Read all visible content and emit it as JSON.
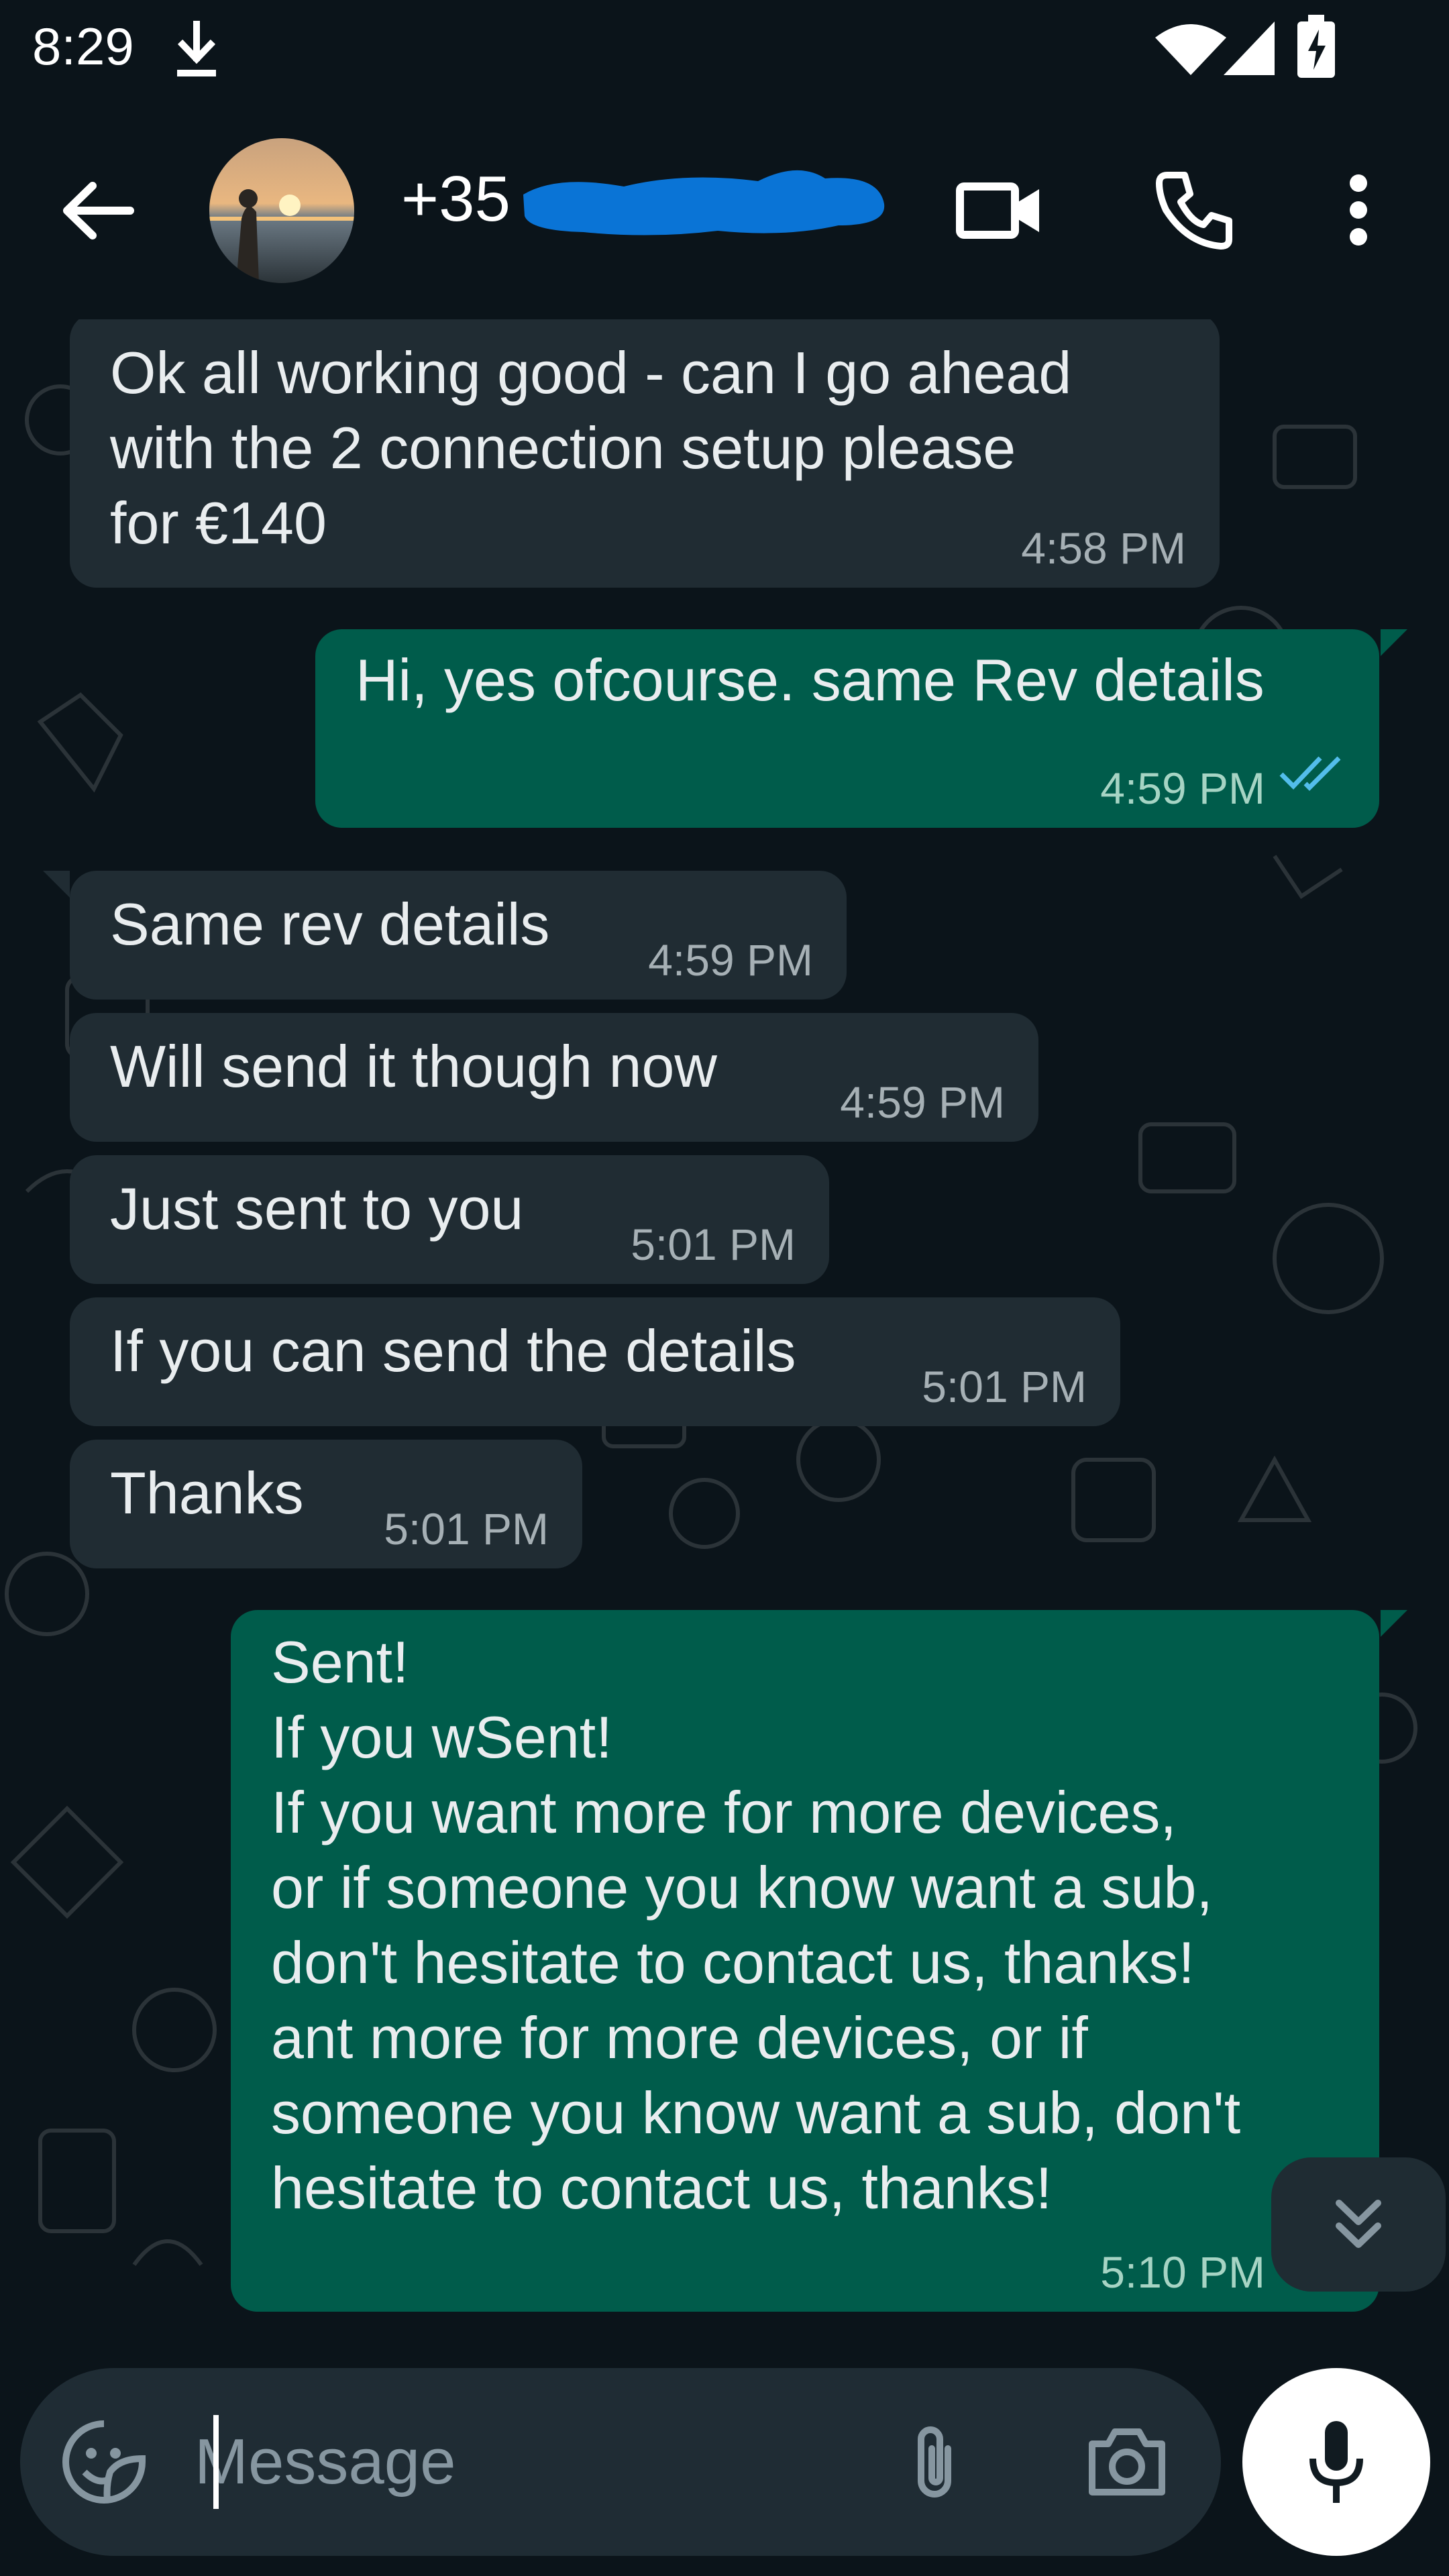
{
  "status_bar": {
    "time": "8:29",
    "icons": [
      "download-icon",
      "wifi-icon",
      "signal-icon",
      "battery-charging-icon"
    ]
  },
  "header": {
    "contact_name": "+35",
    "icons": [
      "back-arrow-icon",
      "video-call-icon",
      "phone-call-icon",
      "more-vert-icon"
    ]
  },
  "messages": [
    {
      "direction": "in",
      "text": "Ok all working good - can I go ahead\nwith the 2 connection setup please\nfor €140",
      "time": "4:58 PM"
    },
    {
      "direction": "out",
      "text": "Hi, yes ofcourse. same Rev details",
      "time": "4:59 PM",
      "status": "read"
    },
    {
      "direction": "in",
      "text": "Same rev details",
      "time": "4:59 PM"
    },
    {
      "direction": "in",
      "text": "Will send it though now",
      "time": "4:59 PM"
    },
    {
      "direction": "in",
      "text": "Just sent to you",
      "time": "5:01 PM"
    },
    {
      "direction": "in",
      "text": "If you can send the details",
      "time": "5:01 PM"
    },
    {
      "direction": "in",
      "text": "Thanks",
      "time": "5:01 PM"
    },
    {
      "direction": "out",
      "text": "Sent!\nIf you wSent!\nIf you want more for more devices,\nor if someone you know want a sub,\ndon't hesitate to contact us, thanks!\nant more for more devices, or if\nsomeone you know want a sub, don't\nhesitate to contact us, thanks!",
      "time": "5:10 PM",
      "status": "read"
    }
  ],
  "composer": {
    "placeholder": "Message",
    "icons": [
      "emoji-sticker-icon",
      "attach-icon",
      "camera-icon",
      "mic-icon"
    ]
  },
  "colors": {
    "background": "#0b141a",
    "incoming_bubble": "#202c33",
    "outgoing_bubble": "#005c4b",
    "read_ticks": "#53bdeb",
    "redaction": "#0a74d6"
  }
}
